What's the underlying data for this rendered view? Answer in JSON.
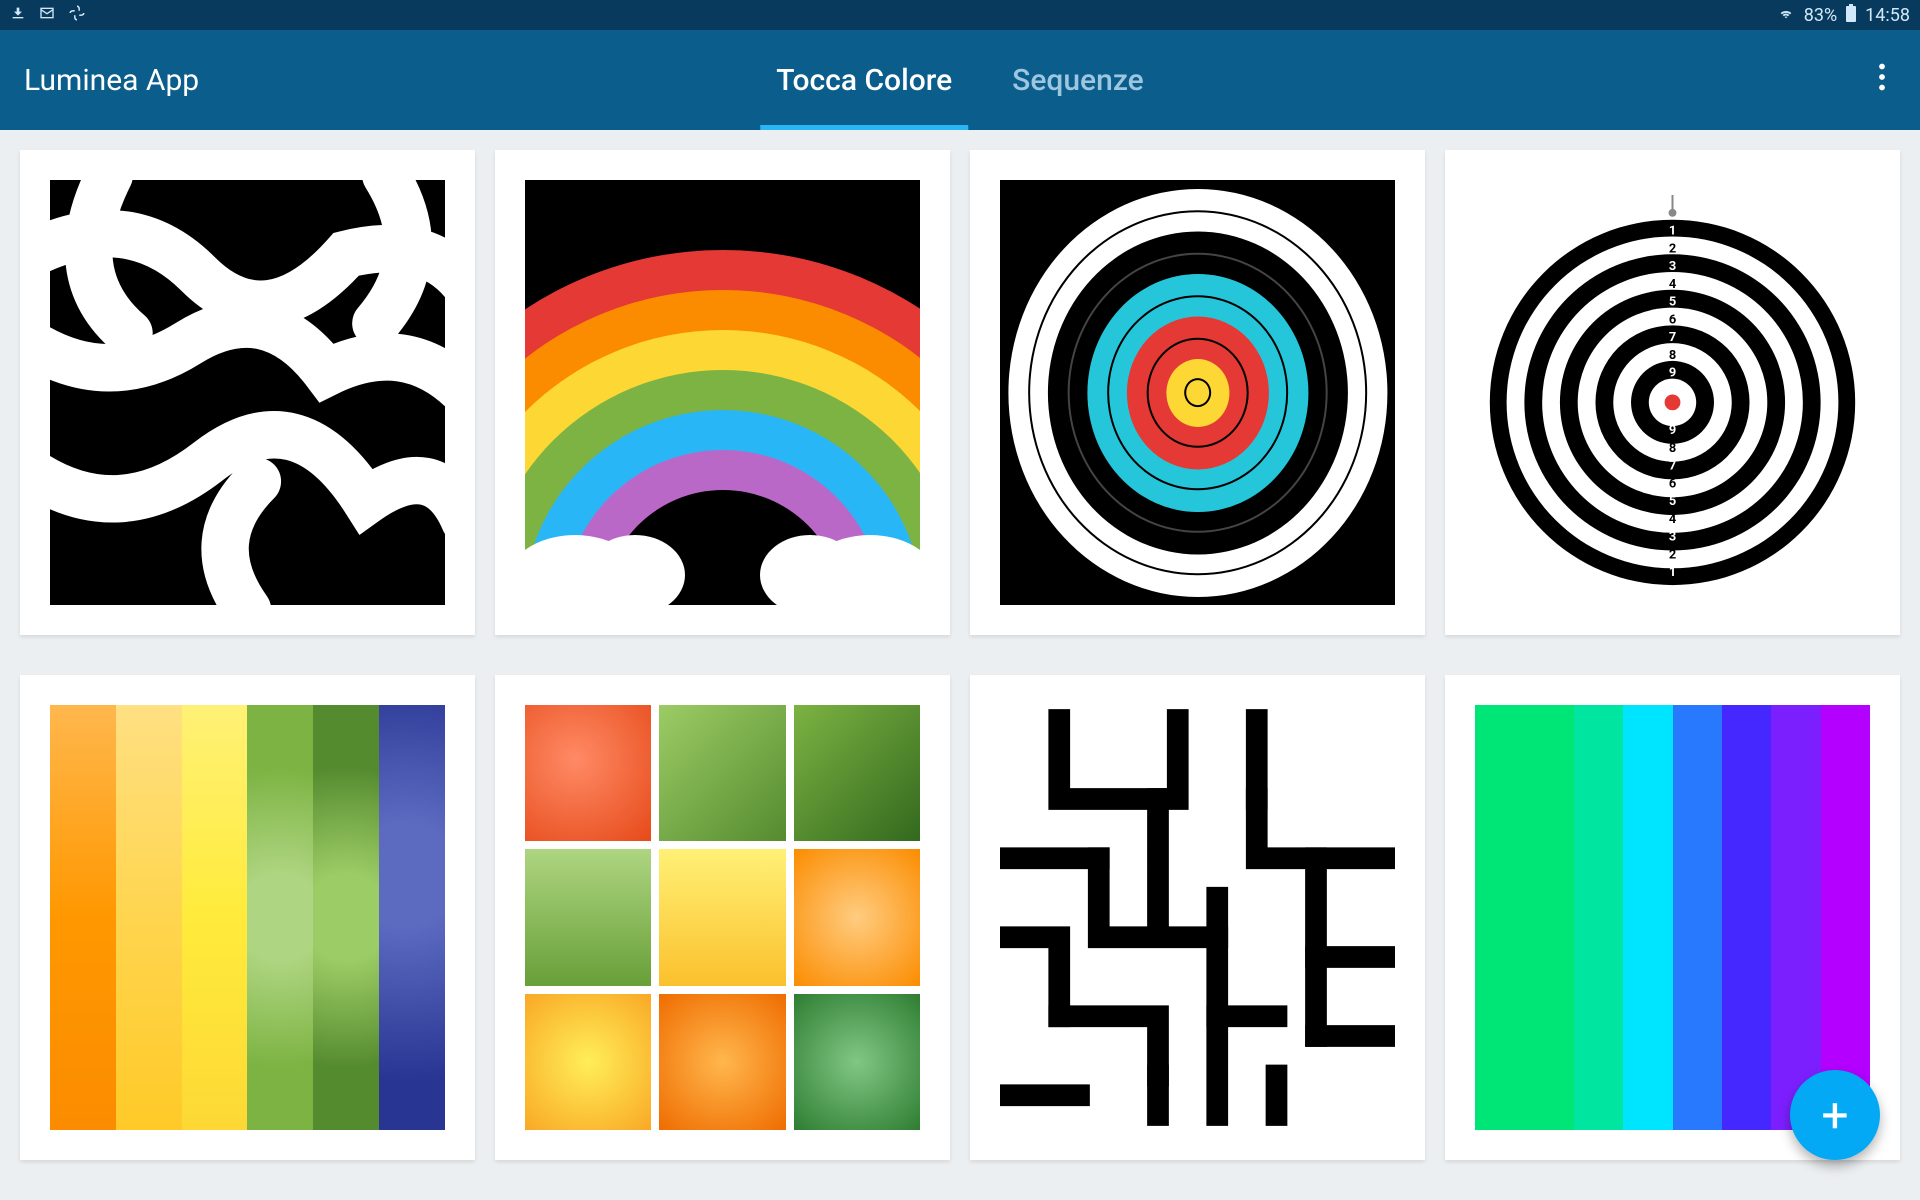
{
  "status": {
    "battery": "83%",
    "time": "14:58"
  },
  "app": {
    "title": "Luminea App"
  },
  "tabs": {
    "active": "Tocca Colore",
    "inactive": "Sequenze"
  },
  "grid": {
    "items": [
      {
        "name": "squiggle-pattern"
      },
      {
        "name": "rainbow"
      },
      {
        "name": "archery-target"
      },
      {
        "name": "dartboard"
      },
      {
        "name": "fruit-stripes"
      },
      {
        "name": "fruit-grid"
      },
      {
        "name": "maze"
      },
      {
        "name": "color-spectrum"
      }
    ]
  },
  "rainbow_colors": [
    "#e53935",
    "#fb8c00",
    "#fdd835",
    "#7cb342",
    "#29b6f6",
    "#ba68c8"
  ],
  "archery_rings": [
    {
      "size": 100,
      "color": "#ffffff"
    },
    {
      "size": 90,
      "color": "#ffffff",
      "border": "#000"
    },
    {
      "size": 80,
      "color": "#000000"
    },
    {
      "size": 70,
      "color": "#000000",
      "border": "#fff"
    },
    {
      "size": 60,
      "color": "#26c6da"
    },
    {
      "size": 50,
      "color": "#26c6da",
      "border": "#000"
    },
    {
      "size": 40,
      "color": "#e53935"
    },
    {
      "size": 30,
      "color": "#e53935",
      "border": "#000"
    },
    {
      "size": 20,
      "color": "#fdd835"
    },
    {
      "size": 10,
      "color": "#fdd835",
      "border": "#000"
    }
  ],
  "dartboard_numbers": [
    "1",
    "2",
    "3",
    "4",
    "5",
    "6",
    "7",
    "8",
    "9",
    "9",
    "8",
    "7",
    "6",
    "5",
    "4",
    "3",
    "2",
    "1"
  ],
  "fruit_stripe_colors": [
    "#ff9800",
    "#ffc107",
    "#ffeb3b",
    "#8bc34a",
    "#689f38",
    "#3f51b5"
  ],
  "fruit_grid_colors": [
    "#ff7043",
    "#7cb342",
    "#558b2f",
    "#9ccc65",
    "#ffeb3b",
    "#ffb74d",
    "#fdd835",
    "#ff9800",
    "#66bb6a"
  ],
  "spectrum_colors": [
    "#00e676",
    "#00e676",
    "#1de9b6",
    "#00e5ff",
    "#2979ff",
    "#651fff",
    "#d500f9",
    "#6200ea"
  ],
  "fab": {
    "icon": "+"
  }
}
